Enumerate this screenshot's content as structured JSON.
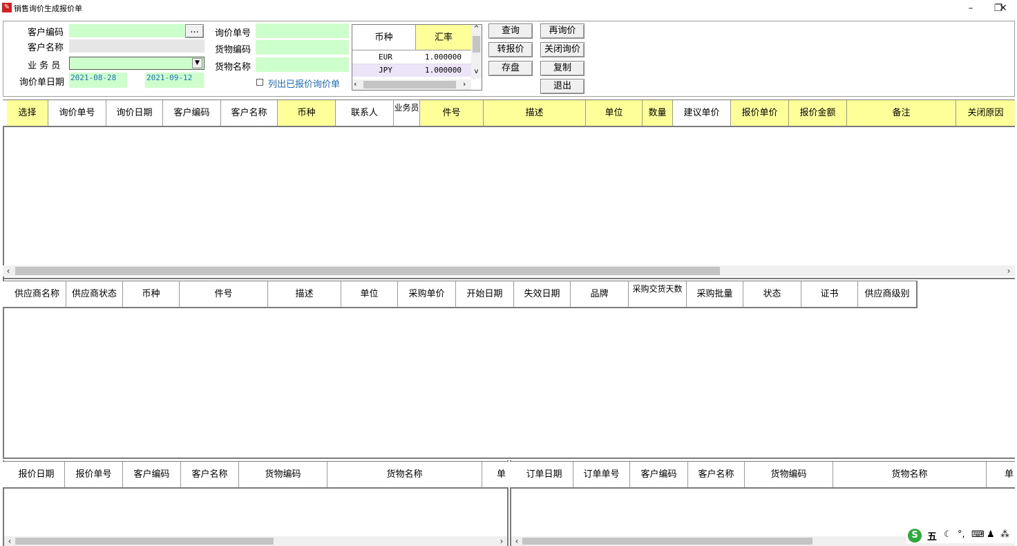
{
  "window": {
    "title": "销售询价生成报价单",
    "minimize": "–",
    "restore": "❐",
    "close": "✕"
  },
  "filters": {
    "customer_code_label": "客户编码",
    "customer_code_value": "",
    "browse_button": "...",
    "customer_name_label": "客户名称",
    "customer_name_value": "",
    "salesperson_label": "业 务 员",
    "salesperson_value": "",
    "inquiry_date_label": "询价单日期",
    "date_from": "2021-08-28",
    "date_to": "2021-09-12",
    "inquiry_no_label": "询价单号",
    "goods_code_label": "货物编码",
    "goods_name_label": "货物名称",
    "show_quoted_label": "列出已报价询价单",
    "show_quoted_checked": false
  },
  "currency_grid": {
    "headers": [
      "币种",
      "汇率"
    ],
    "rows": [
      {
        "currency": "EUR",
        "rate": "1.000000"
      },
      {
        "currency": "JPY",
        "rate": "1.000000"
      }
    ]
  },
  "buttons": {
    "query": "查询",
    "re_inquiry": "再询价",
    "to_quote": "转报价",
    "close_inquiry": "关闭询价",
    "save": "存盘",
    "copy": "复制",
    "exit": "退出"
  },
  "inquiry_grid": {
    "columns": [
      "选择",
      "询价单号",
      "询价日期",
      "客户编码",
      "客户名称",
      "币种",
      "联系人",
      "业务员",
      "件号",
      "描述",
      "单位",
      "数量",
      "建议单价",
      "报价单价",
      "报价金额",
      "备注",
      "关闭原因"
    ]
  },
  "supplier_grid": {
    "columns": [
      "供应商名称",
      "供应商状态",
      "币种",
      "件号",
      "描述",
      "单位",
      "采购单价",
      "开始日期",
      "失效日期",
      "品牌",
      "采购交货天数",
      "采购批量",
      "状态",
      "证书",
      "供应商级别"
    ]
  },
  "quote_grid": {
    "columns": [
      "报价日期",
      "报价单号",
      "客户编码",
      "客户名称",
      "货物编码",
      "货物名称",
      "单"
    ]
  },
  "order_grid": {
    "columns": [
      "订单日期",
      "订单单号",
      "客户编码",
      "客户名称",
      "货物编码",
      "货物名称",
      "单"
    ]
  },
  "ime_toolbar": {
    "logo": "S",
    "mode": "五",
    "items": [
      "☾",
      "°,",
      "⌨",
      "♟",
      "⁂"
    ]
  },
  "colors": {
    "input_green": "#ccffcc",
    "header_yellow": "#ffff99",
    "date_blue": "#1a6fbf",
    "link_blue": "#1a6fbf"
  }
}
